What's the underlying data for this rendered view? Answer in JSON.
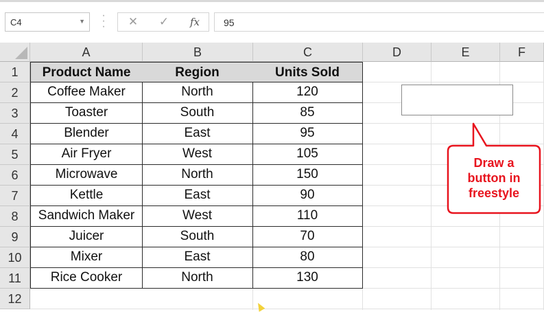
{
  "formula_bar": {
    "name_box": "C4",
    "cancel_icon": "✕",
    "enter_icon": "✓",
    "fx_label": "fx",
    "formula_value": "95"
  },
  "columns": [
    "A",
    "B",
    "C",
    "D",
    "E",
    "F"
  ],
  "rows": [
    "1",
    "2",
    "3",
    "4",
    "5",
    "6",
    "7",
    "8",
    "9",
    "10",
    "11",
    "12"
  ],
  "table": {
    "headers": [
      "Product Name",
      "Region",
      "Units Sold"
    ],
    "rows": [
      [
        "Coffee Maker",
        "North",
        "120"
      ],
      [
        "Toaster",
        "South",
        "85"
      ],
      [
        "Blender",
        "East",
        "95"
      ],
      [
        "Air Fryer",
        "West",
        "105"
      ],
      [
        "Microwave",
        "North",
        "150"
      ],
      [
        "Kettle",
        "East",
        "90"
      ],
      [
        "Sandwich Maker",
        "West",
        "110"
      ],
      [
        "Juicer",
        "South",
        "70"
      ],
      [
        "Mixer",
        "East",
        "80"
      ],
      [
        "Rice Cooker",
        "North",
        "130"
      ]
    ]
  },
  "callout": {
    "line1": "Draw a",
    "line2": "button in",
    "line3": "freestyle",
    "color": "#e8141e"
  },
  "colors": {
    "header_fill": "#d9d9d9",
    "grid_header": "#e6e6e6"
  }
}
